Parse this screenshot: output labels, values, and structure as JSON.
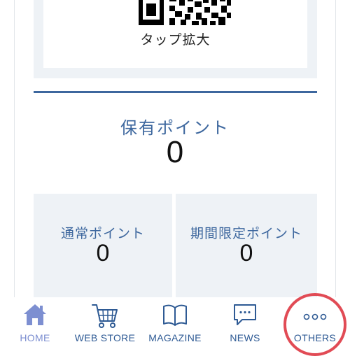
{
  "qr": {
    "tap_label": "タップ拡大"
  },
  "points": {
    "title": "保有ポイント",
    "value": "0"
  },
  "normal_points": {
    "label": "通常ポイント",
    "value": "0"
  },
  "limited_points": {
    "label": "期間限定ポイント",
    "value": "0"
  },
  "nav": {
    "items": [
      {
        "label": "HOME",
        "icon": "home-icon",
        "active": true
      },
      {
        "label": "WEB STORE",
        "icon": "cart-icon"
      },
      {
        "label": "MAGAZINE",
        "icon": "book-icon"
      },
      {
        "label": "NEWS",
        "icon": "chat-bubble-icon"
      },
      {
        "label": "OTHERS",
        "icon": "more-dots-icon"
      }
    ]
  },
  "colors": {
    "accent": "#3d679e",
    "active_nav": "#7d8fd1",
    "highlight_circle": "#e14b55",
    "panel_bg": "#eef2f6"
  }
}
